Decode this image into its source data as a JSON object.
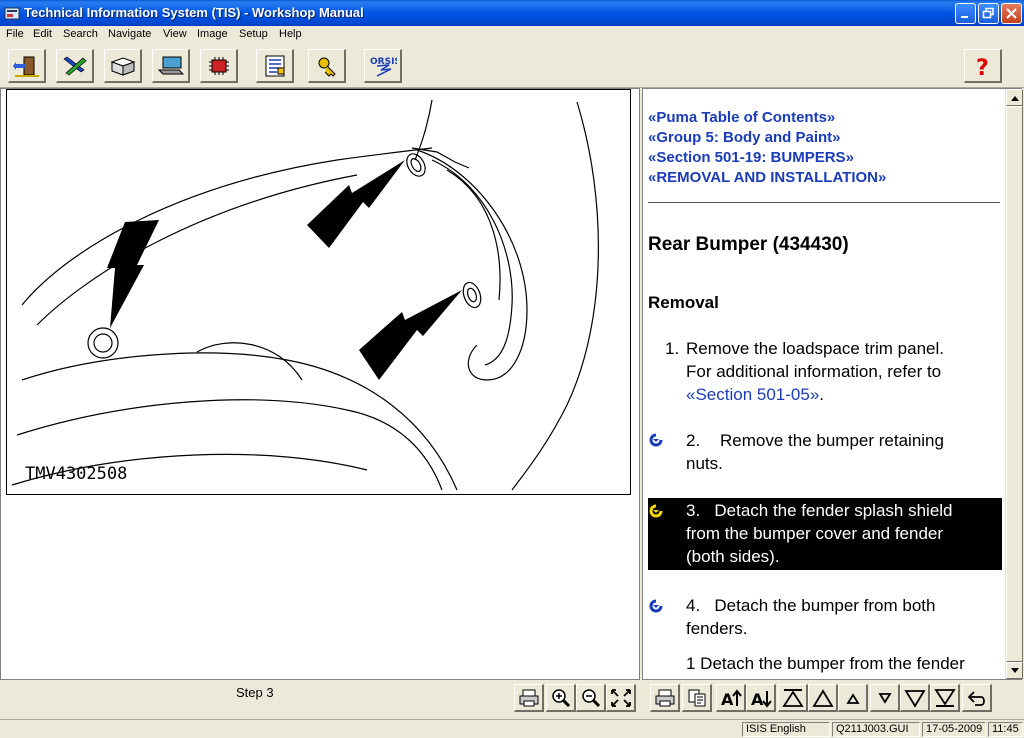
{
  "window": {
    "title": "Technical Information System (TIS) - Workshop Manual"
  },
  "menu": [
    "File",
    "Edit",
    "Search",
    "Navigate",
    "View",
    "Image",
    "Setup",
    "Help"
  ],
  "toolbar": {
    "orsis_label": "ORSIS"
  },
  "diagram": {
    "code": "TMV4302508"
  },
  "toc": [
    "«Puma Table of Contents»",
    "«Group 5: Body and Paint»",
    "«Section 501-19: BUMPERS»",
    "«REMOVAL AND INSTALLATION»"
  ],
  "doc": {
    "title": "Rear Bumper (434430)",
    "section": "Removal",
    "step1_num": "1.",
    "step1_line1": "Remove the loadspace trim panel.",
    "step1_line2": "For additional information, refer to",
    "step1_link": "«Section 501-05»",
    "step1_end": ".",
    "step2_num": "2.",
    "step2_line1": "Remove the bumper retaining",
    "step2_line2": "nuts.",
    "step3_num": "3.",
    "step3_line1": "Detach the fender splash shield",
    "step3_line2": "from the bumper cover and fender",
    "step3_line3": "(both sides).",
    "step4_num": "4.",
    "step4_line1": "Detach the bumper from both",
    "step4_line2": "fenders.",
    "sub1": "1  Detach the bumper from the fender"
  },
  "bottom": {
    "step_label": "Step 3"
  },
  "status": {
    "lang": "ISIS English",
    "file": "Q211J003.GUI",
    "date": "17-05-2009",
    "time": "11:45"
  },
  "colors": {
    "link": "#1a3cb8",
    "titlebar": "#0055e5",
    "highlight": "#000000",
    "active_bullet": "#f5d800"
  }
}
